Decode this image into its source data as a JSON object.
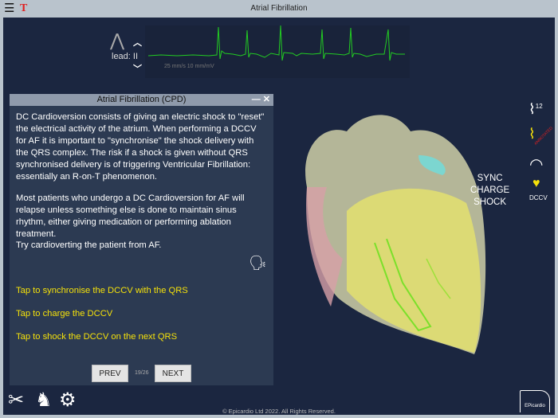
{
  "header": {
    "title": "Atrial Fibrillation",
    "menu_icon": "hamburger-icon",
    "logo": "T"
  },
  "ecg": {
    "lead_label": "lead: II",
    "scale": "25 mm/s  10 mm/mV",
    "color": "#22cc22"
  },
  "panel": {
    "title": "Atrial Fibrillation (CPD)",
    "minimize": "—",
    "close": "✕",
    "paragraphs": [
      "DC Cardioversion consists of giving an electric shock to \"reset\" the electrical activity of the atrium.  When performing a DCCV for AF it is important to \"synchronise\" the shock delivery with the QRS complex.  The risk if a shock is given without QRS synchronised delivery is of triggering Ventricular Fibrillation: essentially an R-on-T phenomenon.",
      "Most patients who undergo a DC Cardioversion for AF will relapse unless something else is done to maintain sinus rhythm, either giving medication or performing ablation treatment.",
      "Try cardioverting the patient from AF."
    ],
    "actions": [
      "Tap to synchronise the DCCV with the QRS",
      "Tap to charge the DCCV",
      "Tap to shock the DCCV on the next QRS"
    ],
    "prev": "PREV",
    "next": "NEXT",
    "page": "19/26"
  },
  "side": {
    "sync": "SYNC",
    "charge": "CHARGE",
    "shock": "SHOCK",
    "twelve": "12",
    "annotated": "ANNOTATED",
    "dccv": "DCCV"
  },
  "footer": {
    "copyright": "© Epicardio Ltd 2022. All Rights Reserved.",
    "brand": "EPicardio"
  }
}
